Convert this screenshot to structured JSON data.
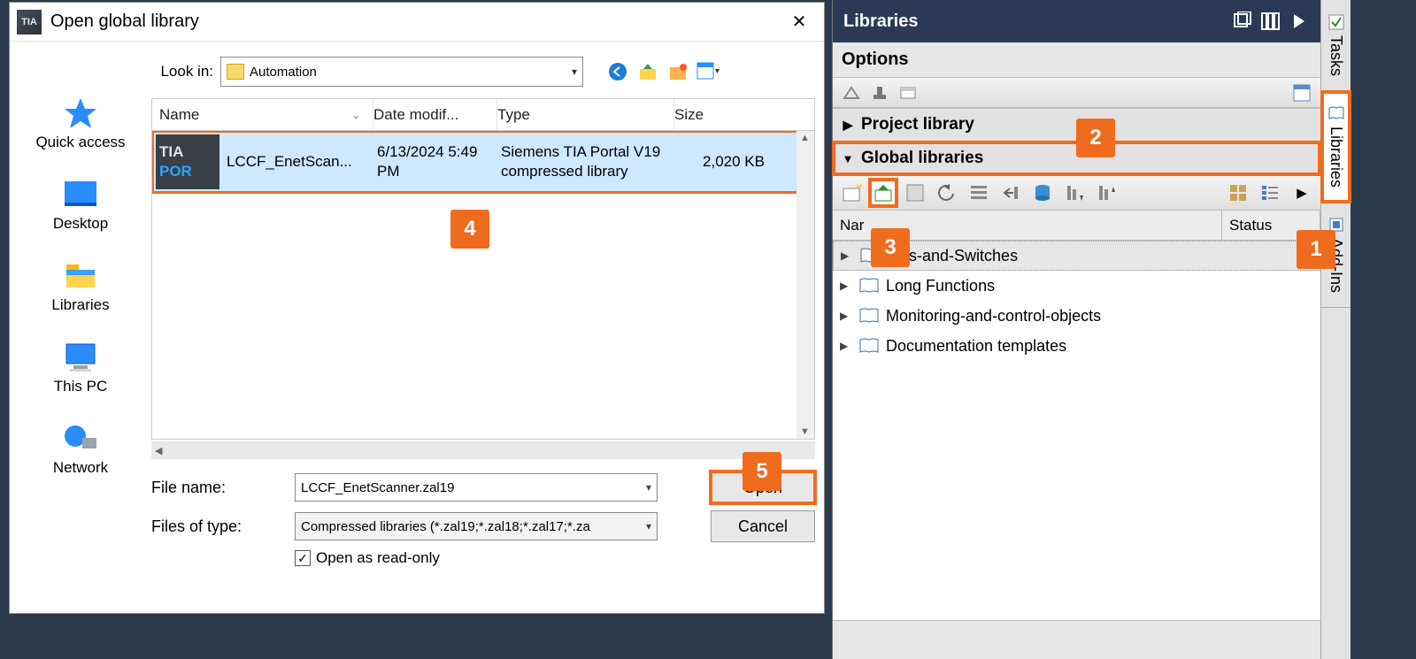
{
  "dialog": {
    "app_icon_text": "TIA",
    "title": "Open global library",
    "lookin_label": "Look in:",
    "lookin_value": "Automation",
    "columns": {
      "name": "Name",
      "date": "Date modif...",
      "type": "Type",
      "size": "Size"
    },
    "file": {
      "thumb_line1": "TIA",
      "thumb_line2": "POR",
      "name": "LCCF_EnetScan...",
      "date": "6/13/2024 5:49 PM",
      "type": "Siemens TIA Portal V19 compressed library",
      "size": "2,020 KB"
    },
    "filename_label": "File name:",
    "filename_value": "LCCF_EnetScanner.zal19",
    "filetype_label": "Files of type:",
    "filetype_value": "Compressed libraries (*.zal19;*.zal18;*.zal17;*.za",
    "readonly_label": "Open as read-only",
    "open_btn": "Open",
    "cancel_btn": "Cancel",
    "nav": [
      "Quick access",
      "Desktop",
      "Libraries",
      "This PC",
      "Network"
    ]
  },
  "panel": {
    "title": "Libraries",
    "options_title": "Options",
    "project_library": "Project library",
    "global_libraries": "Global libraries",
    "tree_columns": {
      "name": "Nar",
      "status": "Status"
    },
    "tree_items": [
      "tons-and-Switches",
      "Long Functions",
      "Monitoring-and-control-objects",
      "Documentation templates"
    ]
  },
  "side_tabs": [
    "Tasks",
    "Libraries",
    "Add-Ins"
  ],
  "callouts": {
    "c1": "1",
    "c2": "2",
    "c3": "3",
    "c4": "4",
    "c5": "5"
  }
}
